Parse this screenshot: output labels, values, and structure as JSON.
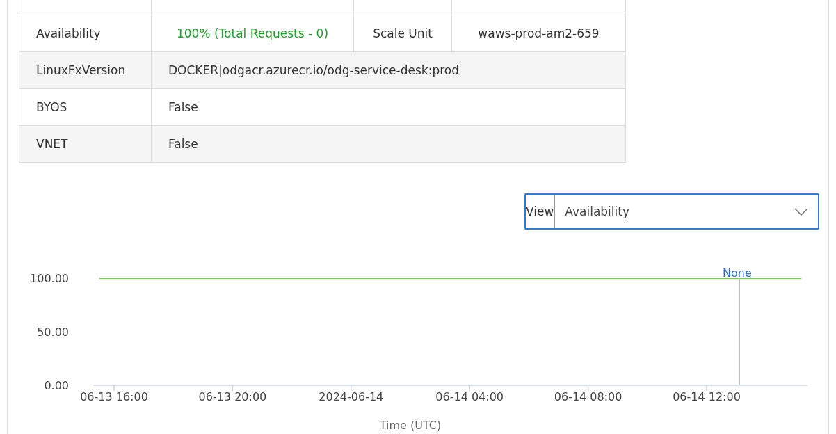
{
  "table": {
    "rows": [
      {
        "cells": [
          {
            "text": "Availability",
            "kind": "label"
          },
          {
            "text": "100% (Total Requests - 0)",
            "kind": "good"
          },
          {
            "text": "Scale Unit",
            "kind": "label"
          },
          {
            "text": "waws-prod-am2-659",
            "kind": "value"
          }
        ]
      },
      {
        "cells": [
          {
            "text": "LinuxFxVersion",
            "kind": "label"
          },
          {
            "text": "DOCKER|odgacr.azurecr.io/odg-service-desk:prod",
            "kind": "value"
          }
        ]
      },
      {
        "cells": [
          {
            "text": "BYOS",
            "kind": "label"
          },
          {
            "text": "False",
            "kind": "value"
          }
        ]
      },
      {
        "cells": [
          {
            "text": "VNET",
            "kind": "label"
          },
          {
            "text": "False",
            "kind": "value"
          }
        ]
      }
    ]
  },
  "view_select": {
    "label": "View",
    "value": "Availability"
  },
  "chart": {
    "chart_data": {
      "type": "line",
      "xlabel": "Time (UTC)",
      "x": [
        "2024-06-13T15:30",
        "2024-06-14T15:12"
      ],
      "series": [
        {
          "color": "#7cc46a",
          "values": [
            100,
            100
          ]
        }
      ],
      "ref_lines": [
        {
          "axis": "x",
          "value": "2024-06-14T13:06",
          "label": "None",
          "color": "#999999"
        }
      ],
      "xlim": [
        "2024-06-13T15:18",
        "2024-06-14T15:24"
      ],
      "ylim": [
        0,
        100
      ],
      "xticks": [
        {
          "value": "2024-06-13T16:00",
          "label": "06-13 16:00"
        },
        {
          "value": "2024-06-13T20:00",
          "label": "06-13 20:00"
        },
        {
          "value": "2024-06-14T00:00",
          "label": "2024-06-14"
        },
        {
          "value": "2024-06-14T04:00",
          "label": "06-14 04:00"
        },
        {
          "value": "2024-06-14T08:00",
          "label": "06-14 08:00"
        },
        {
          "value": "2024-06-14T12:00",
          "label": "06-14 12:00"
        }
      ],
      "yticks": [
        {
          "value": 0,
          "label": "0.00"
        },
        {
          "value": 50,
          "label": "50.00"
        },
        {
          "value": 100,
          "label": "100.00"
        }
      ]
    }
  }
}
